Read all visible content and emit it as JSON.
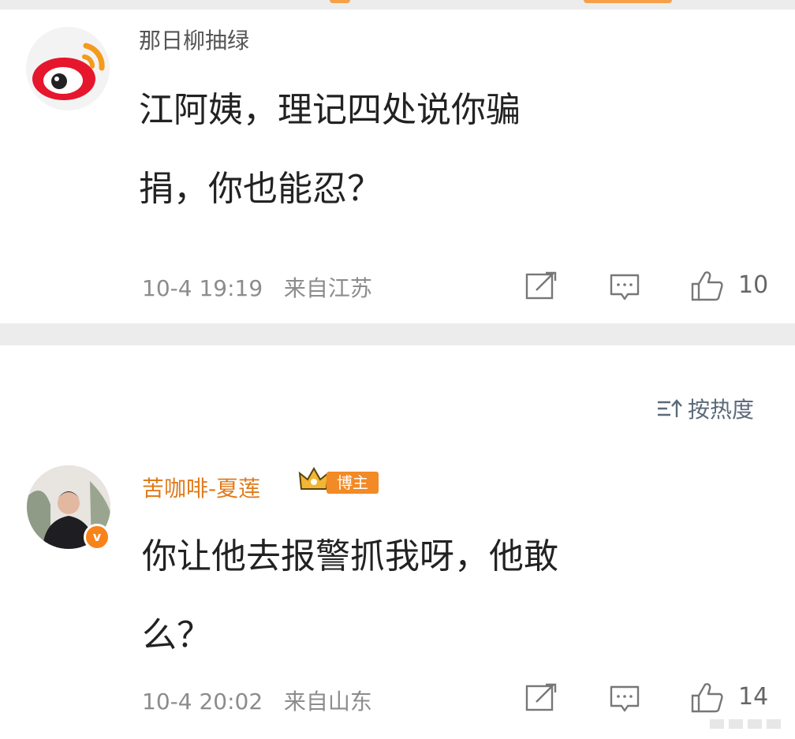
{
  "colors": {
    "accent": "#f7831a",
    "username_vip": "#e07b1b",
    "text_primary": "#222222",
    "text_meta": "#8c8c8c"
  },
  "comments": [
    {
      "username": "那日柳抽绿",
      "avatar_icon": "weibo-logo-icon",
      "content": "江阿姨，理记四处说你骗\n捐，你也能忍？",
      "time": "10-4 19:19",
      "location": "来自江苏",
      "likes": "10"
    },
    {
      "username": "苦咖啡-夏莲",
      "avatar_icon": "user-photo",
      "badge": "博主",
      "verified_mark": "v",
      "content": "你让他去报警抓我呀，他敢\n么？",
      "time": "10-4 20:02",
      "location": "来自山东",
      "likes": "14"
    }
  ],
  "sort": {
    "label": "按热度",
    "icon": "sort-icon"
  }
}
